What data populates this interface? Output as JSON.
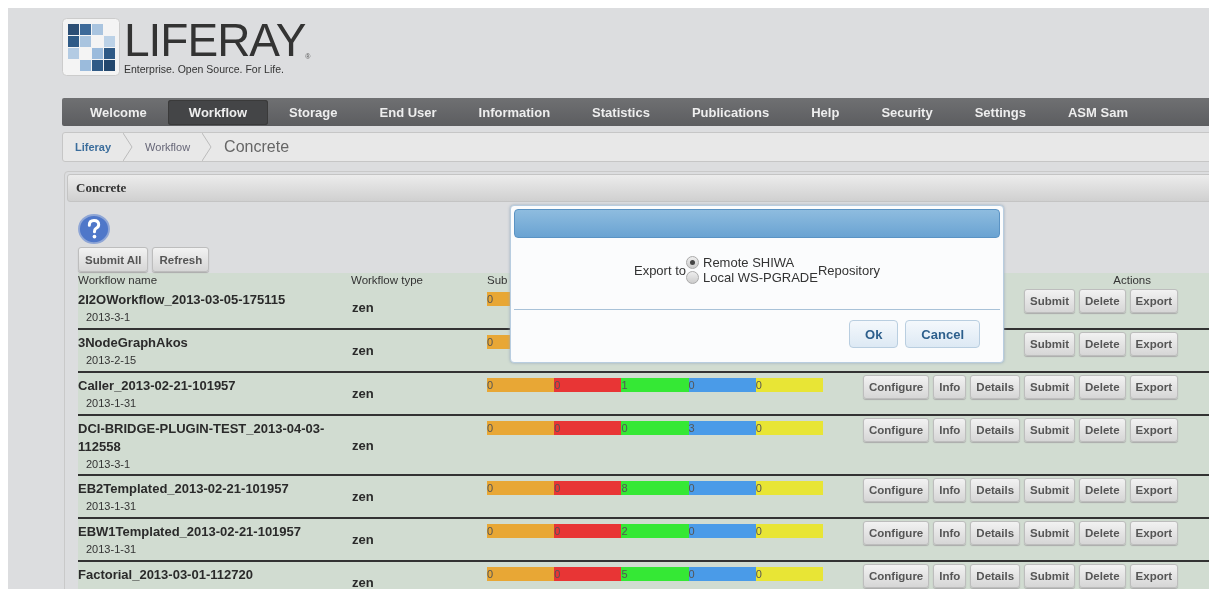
{
  "logo": {
    "name": "LIFERAY",
    "mark": "®",
    "tagline": "Enterprise. Open Source. For Life."
  },
  "nav": [
    {
      "label": "Welcome",
      "selected": false
    },
    {
      "label": "Workflow",
      "selected": true
    },
    {
      "label": "Storage",
      "selected": false
    },
    {
      "label": "End User",
      "selected": false
    },
    {
      "label": "Information",
      "selected": false
    },
    {
      "label": "Statistics",
      "selected": false
    },
    {
      "label": "Publications",
      "selected": false
    },
    {
      "label": "Help",
      "selected": false
    },
    {
      "label": "Security",
      "selected": false
    },
    {
      "label": "Settings",
      "selected": false
    },
    {
      "label": "ASM Sam",
      "selected": false
    }
  ],
  "breadcrumb": [
    {
      "label": "Liferay",
      "kind": "root"
    },
    {
      "label": "Workflow",
      "kind": "link"
    },
    {
      "label": "Concrete",
      "kind": "current"
    }
  ],
  "portlet": {
    "title": "Concrete",
    "toolbar": [
      "Submit All",
      "Refresh"
    ],
    "columns": [
      "Workflow name",
      "Workflow type",
      "Sub",
      "Actions"
    ],
    "rows": [
      {
        "name": "2I2OWorkflow_2013-03-05-175115",
        "date": "2013-3-1",
        "type": "zen",
        "status": [
          {
            "value": "0",
            "color": "#e8a735"
          }
        ],
        "actions": [
          "Submit",
          "Delete",
          "Export"
        ]
      },
      {
        "name": "3NodeGraphAkos",
        "date": "2013-2-15",
        "type": "zen",
        "status": [
          {
            "value": "0",
            "color": "#e8a735"
          }
        ],
        "actions": [
          "Submit",
          "Delete",
          "Export"
        ]
      },
      {
        "name": "Caller_2013-02-21-101957",
        "date": "2013-1-31",
        "type": "zen",
        "status": [
          {
            "value": "0",
            "color": "#e8a735"
          },
          {
            "value": "0",
            "color": "#e83535"
          },
          {
            "value": "1",
            "color": "#35e835"
          },
          {
            "value": "0",
            "color": "#4a9be8"
          },
          {
            "value": "0",
            "color": "#e8e535"
          }
        ],
        "actions": [
          "Configure",
          "Info",
          "Details",
          "Submit",
          "Delete",
          "Export"
        ]
      },
      {
        "name": "DCI-BRIDGE-PLUGIN-TEST_2013-04-03-112558",
        "date": "2013-3-1",
        "type": "zen",
        "status": [
          {
            "value": "0",
            "color": "#e8a735"
          },
          {
            "value": "0",
            "color": "#e83535"
          },
          {
            "value": "0",
            "color": "#35e835"
          },
          {
            "value": "3",
            "color": "#4a9be8"
          },
          {
            "value": "0",
            "color": "#e8e535"
          }
        ],
        "actions": [
          "Configure",
          "Info",
          "Details",
          "Submit",
          "Delete",
          "Export"
        ]
      },
      {
        "name": "EB2Templated_2013-02-21-101957",
        "date": "2013-1-31",
        "type": "zen",
        "status": [
          {
            "value": "0",
            "color": "#e8a735"
          },
          {
            "value": "0",
            "color": "#e83535"
          },
          {
            "value": "8",
            "color": "#35e835"
          },
          {
            "value": "0",
            "color": "#4a9be8"
          },
          {
            "value": "0",
            "color": "#e8e535"
          }
        ],
        "actions": [
          "Configure",
          "Info",
          "Details",
          "Submit",
          "Delete",
          "Export"
        ]
      },
      {
        "name": "EBW1Templated_2013-02-21-101957",
        "date": "2013-1-31",
        "type": "zen",
        "status": [
          {
            "value": "0",
            "color": "#e8a735"
          },
          {
            "value": "0",
            "color": "#e83535"
          },
          {
            "value": "2",
            "color": "#35e835"
          },
          {
            "value": "0",
            "color": "#4a9be8"
          },
          {
            "value": "0",
            "color": "#e8e535"
          }
        ],
        "actions": [
          "Configure",
          "Info",
          "Details",
          "Submit",
          "Delete",
          "Export"
        ]
      },
      {
        "name": "Factorial_2013-03-01-112720",
        "type": "zen",
        "status": [
          {
            "value": "0",
            "color": "#e8a735"
          },
          {
            "value": "0",
            "color": "#e83535"
          },
          {
            "value": "5",
            "color": "#35e835"
          },
          {
            "value": "0",
            "color": "#4a9be8"
          },
          {
            "value": "0",
            "color": "#e8e535"
          }
        ],
        "actions": [
          "Configure",
          "Info",
          "Details",
          "Submit",
          "Delete",
          "Export"
        ]
      }
    ]
  },
  "dialog": {
    "label": "Export to",
    "options": [
      {
        "label": "Remote SHIWA",
        "selected": true
      },
      {
        "label": "Local WS-PGRADE",
        "selected": false
      }
    ],
    "suffix": "Repository",
    "buttons": [
      "Ok",
      "Cancel"
    ]
  }
}
